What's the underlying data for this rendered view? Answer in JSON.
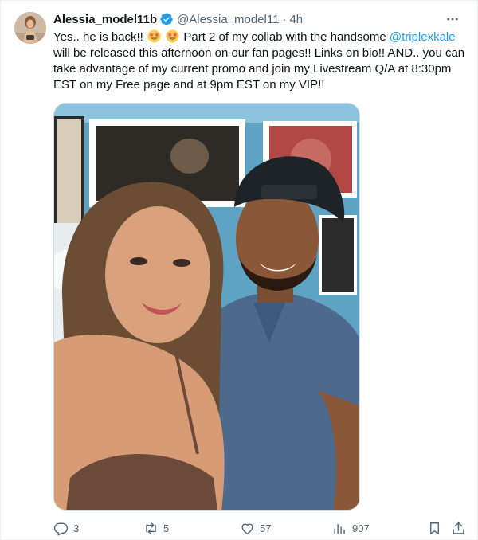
{
  "tweet": {
    "display_name": "Alessia_model11b",
    "handle": "@Alessia_model11",
    "separator": "·",
    "time": "4h",
    "text": {
      "part1": "Yes.. he is back!!",
      "part2": " Part 2 of my collab with the handsome ",
      "mention": "@triplexkale",
      "part3": " will be released this afternoon on our fan pages!! Links on bio!! AND.. you can take advantage of my current promo and join my Livestream Q/A at 8:30pm EST on my Free page and at 9pm EST on my VIP!!"
    },
    "emoji": [
      "star-struck-emoji",
      "star-struck-emoji"
    ],
    "media_description": "selfie of a woman and a man wearing a backwards cap"
  },
  "actions": {
    "replies": "3",
    "reposts": "5",
    "likes": "57",
    "views": "907"
  },
  "colors": {
    "text": "#0f1419",
    "secondary": "#536471",
    "accent": "#1d9bf0",
    "verified": "#1d9bf0"
  },
  "icons": [
    "more-icon",
    "verified-badge-icon",
    "reply-icon",
    "repost-icon",
    "like-icon",
    "views-icon",
    "bookmark-icon",
    "share-icon"
  ]
}
